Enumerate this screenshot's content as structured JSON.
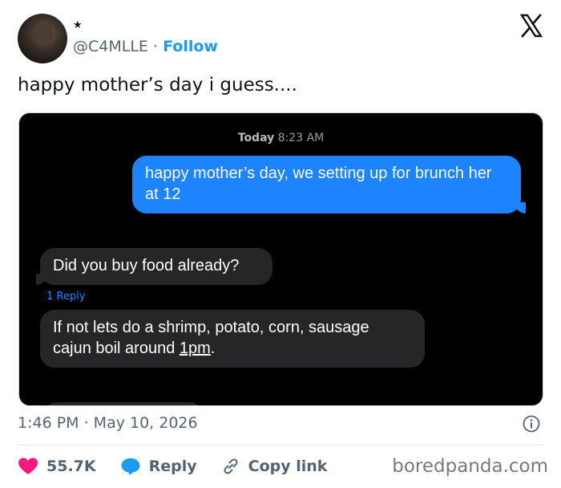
{
  "header": {
    "star": "★",
    "handle": "@C4MLLE",
    "separator": "·",
    "follow_label": "Follow",
    "logo_icon": "x-logo-icon"
  },
  "tweet": {
    "text": "happy mother’s day i guess...."
  },
  "media": {
    "timestamp_day": "Today",
    "timestamp_time": "8:23 AM",
    "messages": [
      {
        "direction": "outgoing",
        "text": "happy mother’s day, we setting up for brunch her at 12"
      },
      {
        "direction": "incoming",
        "text": "Did you buy food already?"
      },
      {
        "direction": "incoming",
        "text_before": "If not lets do a shrimp, potato, corn, sausage cajun boil around ",
        "text_link": "1pm",
        "text_after": "."
      }
    ],
    "reply_count": "1 Reply",
    "colors": {
      "outgoing": "#1d84fe",
      "incoming": "#262628",
      "background": "#000000"
    }
  },
  "footer": {
    "date_text": "1:46 PM · May 10, 2026",
    "likes": "55.7K",
    "reply_label": "Reply",
    "copy_link_label": "Copy link",
    "watermark": "boredpanda.com",
    "colors": {
      "heart": "#f91880",
      "reply": "#1d9bf0",
      "link": "#536471"
    }
  }
}
